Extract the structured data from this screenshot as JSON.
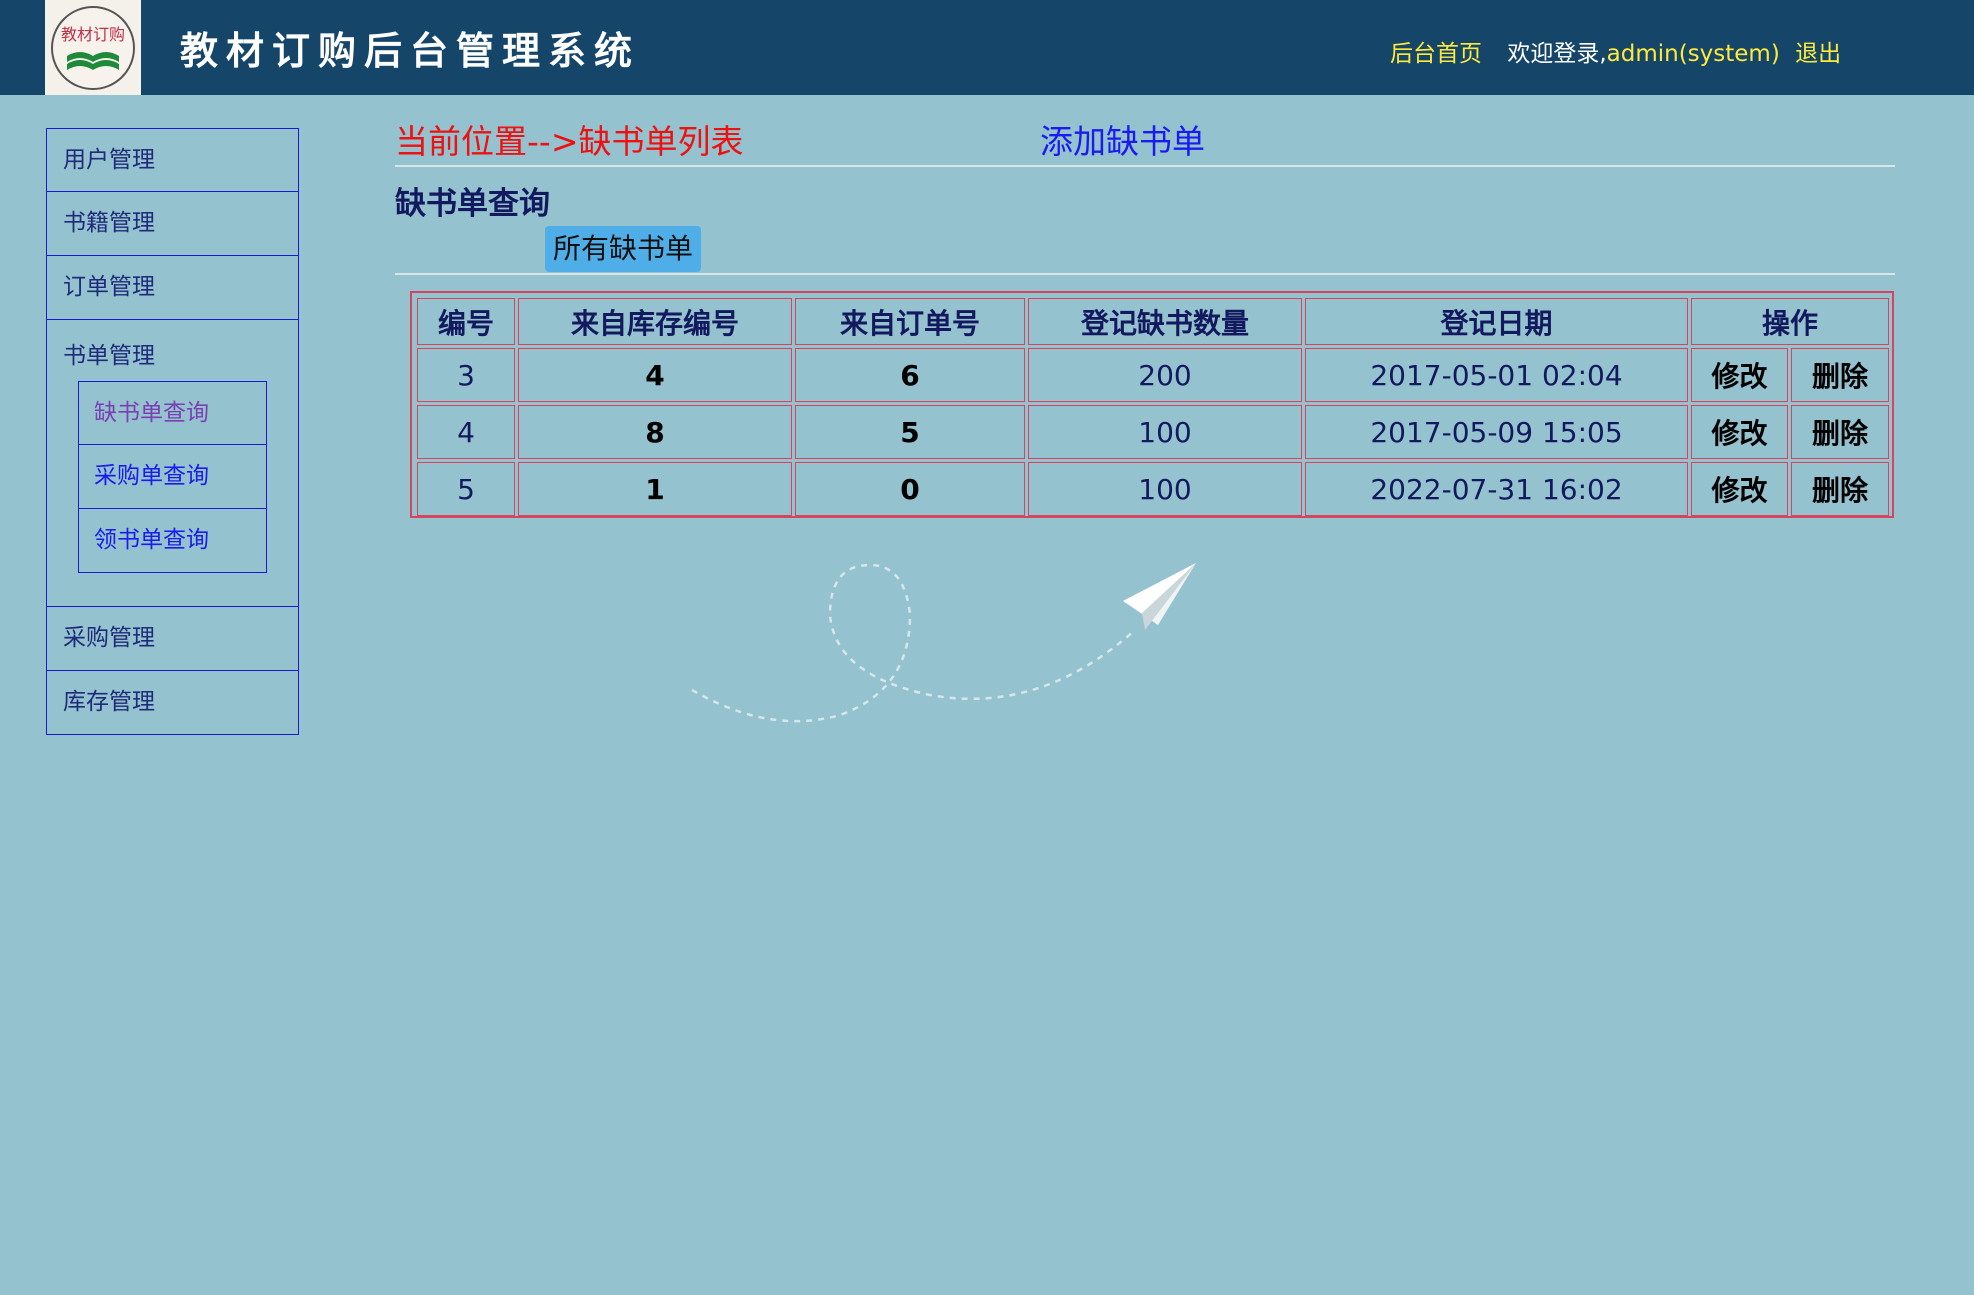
{
  "header": {
    "logo_text": "教材订购",
    "app_title": "教材订购后台管理系统",
    "home_link": "后台首页",
    "welcome_prefix": "欢迎登录,",
    "user": "admin(system)",
    "logout": "退出"
  },
  "sidebar": {
    "items": [
      {
        "label": "用户管理"
      },
      {
        "label": "书籍管理"
      },
      {
        "label": "订单管理"
      }
    ],
    "group": {
      "label": "书单管理",
      "subitems": [
        {
          "label": "缺书单查询"
        },
        {
          "label": "采购单查询"
        },
        {
          "label": "领书单查询"
        }
      ]
    },
    "items_after": [
      {
        "label": "采购管理"
      },
      {
        "label": "库存管理"
      }
    ]
  },
  "main": {
    "breadcrumb": "当前位置-->缺书单列表",
    "add_link": "添加缺书单",
    "query_title": "缺书单查询",
    "all_button": "所有缺书单",
    "table": {
      "headers": [
        "编号",
        "来自库存编号",
        "来自订单号",
        "登记缺书数量",
        "登记日期",
        "操作"
      ],
      "rows": [
        {
          "id": "3",
          "stock_id": "4",
          "order_id": "6",
          "qty": "200",
          "date": "2017-05-01 02:04",
          "edit": "修改",
          "delete": "删除"
        },
        {
          "id": "4",
          "stock_id": "8",
          "order_id": "5",
          "qty": "100",
          "date": "2017-05-09 15:05",
          "edit": "修改",
          "delete": "删除"
        },
        {
          "id": "5",
          "stock_id": "1",
          "order_id": "0",
          "qty": "100",
          "date": "2022-07-31 16:02",
          "edit": "修改",
          "delete": "删除"
        }
      ]
    }
  },
  "colors": {
    "background": "#94c2cf",
    "header": "#15466a",
    "breadcrumb": "#ee1111",
    "link": "#1b1bf0",
    "table_border": "#d6455e",
    "button": "#4faee8"
  }
}
